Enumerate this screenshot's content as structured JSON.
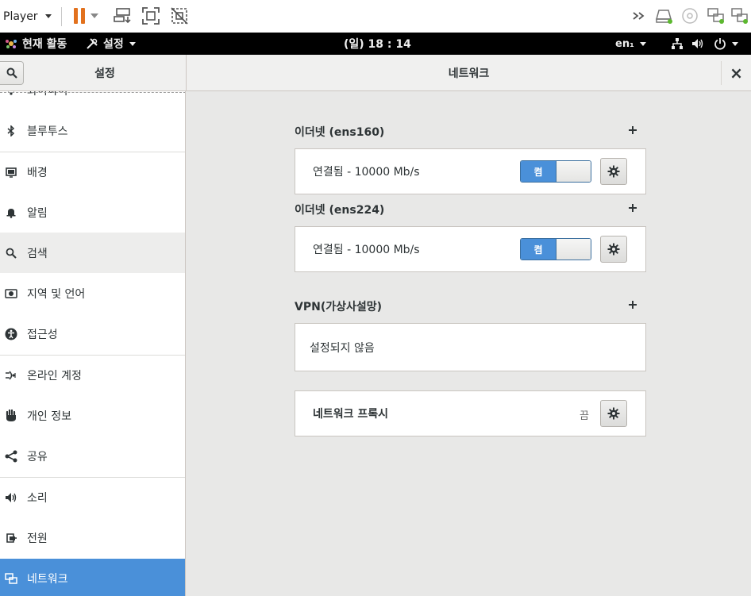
{
  "player": {
    "menu_label": "Player"
  },
  "top_bar": {
    "activities": "현재 활동",
    "app_menu": "설정",
    "clock": "(일) 18 : 14",
    "input_method": "en₁"
  },
  "header": {
    "sidebar_title": "설정",
    "panel_title": "네트워크",
    "close_glyph": "×"
  },
  "sidebar": {
    "items": [
      {
        "label": "와이파이",
        "icon": "wifi-icon"
      },
      {
        "label": "블루투스",
        "icon": "bluetooth-icon"
      },
      {
        "label": "배경",
        "icon": "background-icon"
      },
      {
        "label": "알림",
        "icon": "bell-icon"
      },
      {
        "label": "검색",
        "icon": "search-icon"
      },
      {
        "label": "지역 및 언어",
        "icon": "region-icon"
      },
      {
        "label": "접근성",
        "icon": "accessibility-icon"
      },
      {
        "label": "온라인 계정",
        "icon": "online-accounts-icon"
      },
      {
        "label": "개인 정보",
        "icon": "privacy-hand-icon"
      },
      {
        "label": "공유",
        "icon": "share-icon"
      },
      {
        "label": "소리",
        "icon": "sound-icon"
      },
      {
        "label": "전원",
        "icon": "power-plug-icon"
      },
      {
        "label": "네트워크",
        "icon": "network-icon"
      }
    ],
    "selected": "네트워크"
  },
  "network": {
    "ethernet1": {
      "title": "이더넷 (ens160)",
      "status": "연결됨 - 10000 Mb/s",
      "switch_label": "켬"
    },
    "ethernet2": {
      "title": "이더넷 (ens224)",
      "status": "연결됨 - 10000 Mb/s",
      "switch_label": "켬"
    },
    "vpn": {
      "title": "VPN(가상사설망)",
      "status": "설정되지 않음"
    },
    "proxy": {
      "label": "네트워크 프록시",
      "status": "끔"
    }
  },
  "colors": {
    "accent": "#4a90d9",
    "pause_orange": "#e2711d",
    "top_bar": "#000000"
  }
}
